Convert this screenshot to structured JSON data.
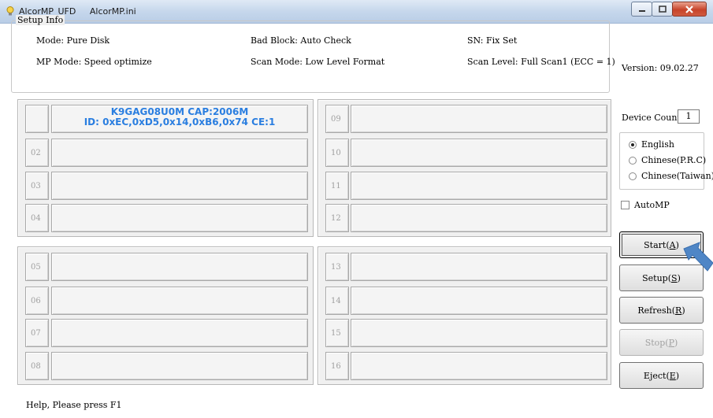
{
  "window": {
    "app_name": "AlcorMP_UFD",
    "ini_file": "AlcorMP.ini"
  },
  "setup_info": {
    "legend": "Setup Info",
    "mode": "Mode: Pure Disk",
    "bad_block": "Bad Block: Auto Check",
    "sn": "SN: Fix Set",
    "mp_mode": "MP Mode: Speed optimize",
    "scan_mode": "Scan Mode: Low Level Format",
    "scan_level": "Scan Level: Full Scan1 (ECC = 1)"
  },
  "version": "Version: 09.02.27",
  "ports": [
    {
      "num": "",
      "info_line1": "K9GAG08U0M CAP:2006M",
      "info_line2": "ID: 0xEC,0xD5,0x14,0xB6,0x74  CE:1"
    },
    {
      "num": "02",
      "info_line1": "",
      "info_line2": ""
    },
    {
      "num": "03",
      "info_line1": "",
      "info_line2": ""
    },
    {
      "num": "04",
      "info_line1": "",
      "info_line2": ""
    },
    {
      "num": "05",
      "info_line1": "",
      "info_line2": ""
    },
    {
      "num": "06",
      "info_line1": "",
      "info_line2": ""
    },
    {
      "num": "07",
      "info_line1": "",
      "info_line2": ""
    },
    {
      "num": "08",
      "info_line1": "",
      "info_line2": ""
    },
    {
      "num": "09",
      "info_line1": "",
      "info_line2": ""
    },
    {
      "num": "10",
      "info_line1": "",
      "info_line2": ""
    },
    {
      "num": "11",
      "info_line1": "",
      "info_line2": ""
    },
    {
      "num": "12",
      "info_line1": "",
      "info_line2": ""
    },
    {
      "num": "13",
      "info_line1": "",
      "info_line2": ""
    },
    {
      "num": "14",
      "info_line1": "",
      "info_line2": ""
    },
    {
      "num": "15",
      "info_line1": "",
      "info_line2": ""
    },
    {
      "num": "16",
      "info_line1": "",
      "info_line2": ""
    }
  ],
  "device_count": {
    "label": "Device Count:",
    "value": "1"
  },
  "languages": [
    {
      "label": "English",
      "selected": true
    },
    {
      "label": "Chinese(P.R.C)",
      "selected": false
    },
    {
      "label": "Chinese(Taiwan)",
      "selected": false
    }
  ],
  "automp": {
    "label": "AutoMP",
    "checked": false
  },
  "buttons": {
    "start": "Start(A)",
    "setup": "Setup(S)",
    "refresh": "Refresh(R)",
    "stop": "Stop(P)",
    "eject": "Eject(E)"
  },
  "status": "Help, Please press F1",
  "colors": {
    "port_info_text": "#2a7ee0",
    "arrow": "#4f86c6",
    "close_button": "#c7442a"
  }
}
